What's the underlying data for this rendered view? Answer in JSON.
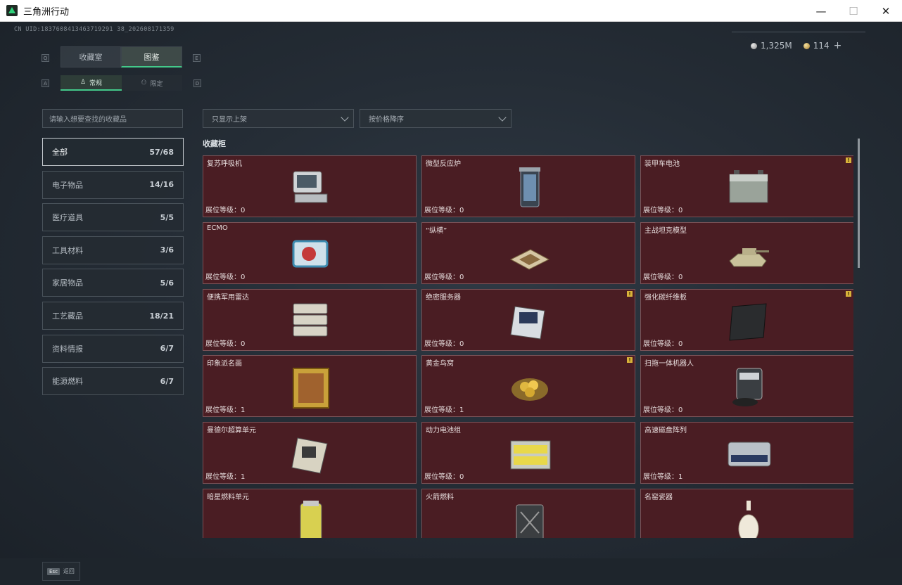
{
  "window": {
    "title": "三角洲行动",
    "minimize": "—",
    "maximize": "☐",
    "close": "✕"
  },
  "uid": "CN UID:1837608413463719291 38_202608171359",
  "currency": {
    "silver": "1,325M",
    "gold": "114",
    "plus": "+"
  },
  "tabs": [
    {
      "label": "收藏室",
      "key": "Q"
    },
    {
      "label": "图鉴",
      "key": "E"
    }
  ],
  "subtabs": [
    {
      "label": "常规",
      "key": "A"
    },
    {
      "label": "限定",
      "key": "D"
    }
  ],
  "search": {
    "placeholder": "请输入想要查找的收藏品"
  },
  "filters": {
    "shelf": "只显示上架",
    "sort": "按价格降序"
  },
  "categories": [
    {
      "label": "全部",
      "count": "57/68"
    },
    {
      "label": "电子物品",
      "count": "14/16"
    },
    {
      "label": "医疗道具",
      "count": "5/5"
    },
    {
      "label": "工具材料",
      "count": "3/6"
    },
    {
      "label": "家居物品",
      "count": "5/6"
    },
    {
      "label": "工艺藏品",
      "count": "18/21"
    },
    {
      "label": "资料情报",
      "count": "6/7"
    },
    {
      "label": "能源燃料",
      "count": "6/7"
    }
  ],
  "section_title": "收藏柜",
  "level_prefix": "展位等级：",
  "warn_symbol": "!",
  "items": [
    {
      "name": "复苏呼吸机",
      "level": "0",
      "warn": false,
      "icon": "ventilator-icon"
    },
    {
      "name": "微型反应炉",
      "level": "0",
      "warn": false,
      "icon": "reactor-icon"
    },
    {
      "name": "装甲车电池",
      "level": "0",
      "warn": true,
      "icon": "battery-icon"
    },
    {
      "name": "ECMO",
      "level": "0",
      "warn": false,
      "icon": "ecmo-icon"
    },
    {
      "name": "“纵横”",
      "level": "0",
      "warn": false,
      "icon": "chessboard-icon"
    },
    {
      "name": "主战坦克模型",
      "level": "0",
      "warn": false,
      "icon": "tank-model-icon"
    },
    {
      "name": "便携军用雷达",
      "level": "0",
      "warn": false,
      "icon": "radar-icon"
    },
    {
      "name": "绝密服务器",
      "level": "0",
      "warn": true,
      "icon": "server-icon"
    },
    {
      "name": "强化碳纤维板",
      "level": "0",
      "warn": true,
      "icon": "carbon-plate-icon"
    },
    {
      "name": "印象派名画",
      "level": "1",
      "warn": false,
      "icon": "painting-icon"
    },
    {
      "name": "黄金鸟窝",
      "level": "1",
      "warn": true,
      "icon": "golden-nest-icon"
    },
    {
      "name": "扫拖一体机器人",
      "level": "0",
      "warn": false,
      "icon": "robot-vacuum-icon"
    },
    {
      "name": "曼德尔超算单元",
      "level": "1",
      "warn": false,
      "icon": "supercomputer-icon"
    },
    {
      "name": "动力电池组",
      "level": "0",
      "warn": false,
      "icon": "battery-pack-icon"
    },
    {
      "name": "高速磁盘阵列",
      "level": "1",
      "warn": false,
      "icon": "disk-array-icon"
    },
    {
      "name": "暗星燃料单元",
      "level": "",
      "warn": false,
      "icon": "fuel-cell-icon"
    },
    {
      "name": "火箭燃料",
      "level": "",
      "warn": false,
      "icon": "jerrycan-icon"
    },
    {
      "name": "名窑瓷器",
      "level": "",
      "warn": false,
      "icon": "porcelain-vase-icon"
    }
  ],
  "bottom": {
    "esc_key": "Esc",
    "back_label": "返回"
  },
  "colors": {
    "accent": "#43c98a",
    "card_bg": "#4a1d23",
    "warn": "#d8b23a"
  }
}
